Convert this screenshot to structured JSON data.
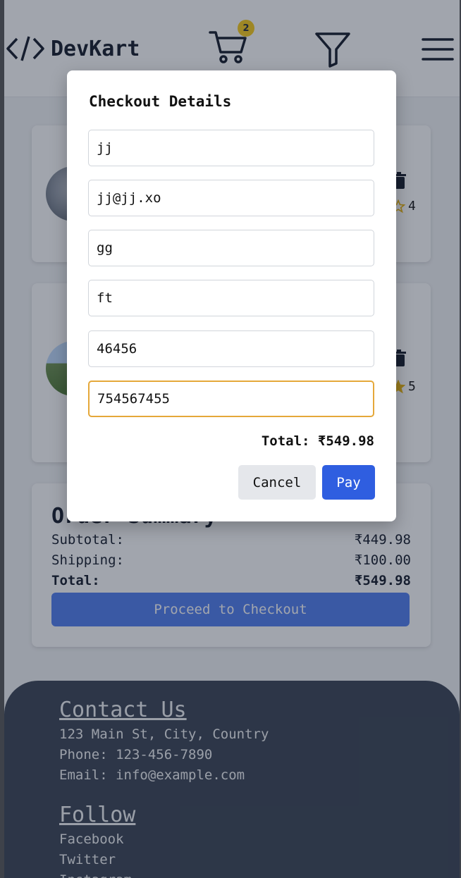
{
  "brand": {
    "name": "DevKart"
  },
  "header": {
    "cart_count": "2",
    "icons": [
      "code-logo-icon",
      "cart-icon",
      "filter-icon",
      "menu-icon"
    ]
  },
  "cart_items": [
    {
      "rating": "4"
    },
    {
      "rating": "5"
    }
  ],
  "summary": {
    "title": "Order Summary",
    "subtotal_label": "Subtotal:",
    "subtotal_value": "₹449.98",
    "shipping_label": "Shipping:",
    "shipping_value": "₹100.00",
    "total_label": "Total:",
    "total_value": "₹549.98",
    "checkout_label": "Proceed to Checkout"
  },
  "footer": {
    "contact_title": "Contact Us",
    "address": "123 Main St, City, Country",
    "phone": "Phone: 123-456-7890",
    "email": "Email: info@example.com",
    "follow_title": "Follow",
    "links": [
      "Facebook",
      "Twitter",
      "Instagram"
    ]
  },
  "modal": {
    "title": "Checkout Details",
    "fields": [
      {
        "value": "jj"
      },
      {
        "value": "jj@jj.xo"
      },
      {
        "value": "gg"
      },
      {
        "value": "ft"
      },
      {
        "value": "46456"
      },
      {
        "value": "754567455"
      }
    ],
    "total": "Total: ₹549.98",
    "cancel_label": "Cancel",
    "pay_label": "Pay"
  },
  "colors": {
    "accent": "#2f5ee0",
    "badge": "#facc15",
    "footer_bg": "#374151",
    "focus_border": "#e5a83a"
  }
}
